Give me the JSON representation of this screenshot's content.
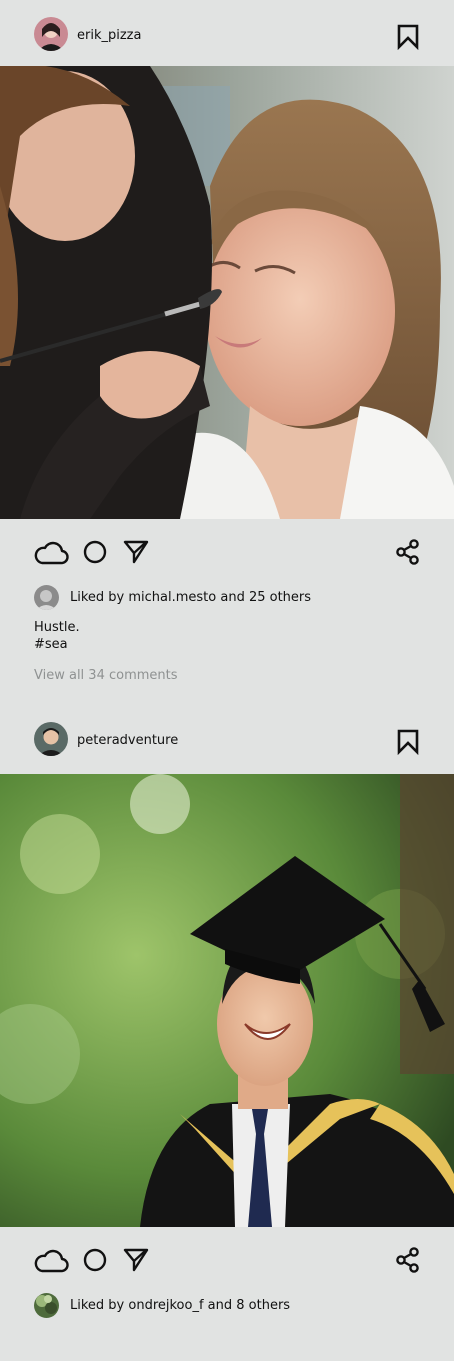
{
  "posts": [
    {
      "username": "erik_pizza",
      "photo_alt": "Makeup artist applying makeup",
      "liked_by_text": "Liked by michal.mesto and 25 others",
      "caption_lines": [
        "Hustle.",
        "#sea"
      ],
      "view_comments": "View all 34 comments"
    },
    {
      "username": "peteradventure",
      "photo_alt": "Smiling graduate in cap and gown",
      "liked_by_text": "Liked by ondrejkoo_f and 8 others"
    }
  ],
  "icons": {
    "like": "cloud-icon",
    "comment": "circle-icon",
    "send": "send-arrow-icon",
    "share": "share-icon",
    "save": "bookmark-icon"
  },
  "colors": {
    "background": "#e1e3e2",
    "text": "#111111",
    "muted": "#8f9292"
  }
}
